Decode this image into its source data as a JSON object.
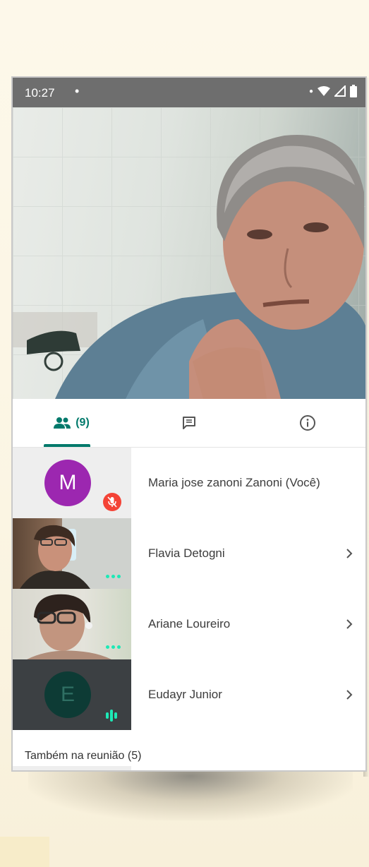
{
  "status_bar": {
    "time": "10:27",
    "dot": "•"
  },
  "tabs": [
    {
      "name": "people",
      "icon": "people-icon",
      "label": "(9)",
      "selected": true
    },
    {
      "name": "chat",
      "icon": "chat-icon",
      "selected": false
    },
    {
      "name": "info",
      "icon": "info-icon",
      "selected": false
    }
  ],
  "participants": [
    {
      "name": "Maria jose zanoni Zanoni (Você)",
      "avatar_letter": "M",
      "avatar_color": "#9c27b0",
      "muted": true
    },
    {
      "name": "Flavia Detogni",
      "video": true
    },
    {
      "name": "Ariane Loureiro",
      "video": true
    },
    {
      "name": "Eudayr Junior",
      "avatar_letter": "E",
      "avatar_color": "#0d3b35",
      "speaking": true
    }
  ],
  "also_in_meeting": {
    "label": "Também na reunião (5)"
  },
  "colors": {
    "accent": "#00796b",
    "mute_badge": "#f44336",
    "speaking": "#1de9b6"
  }
}
